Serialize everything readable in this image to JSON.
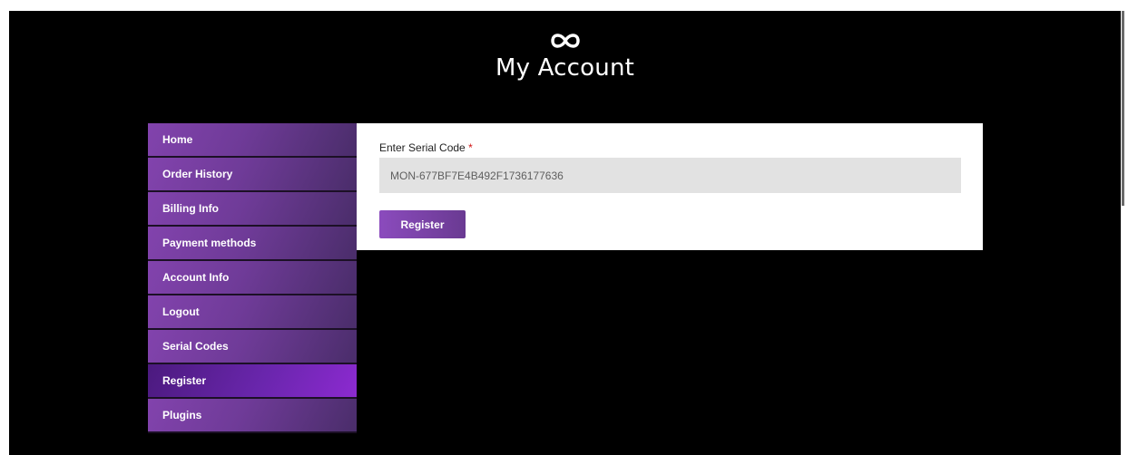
{
  "header": {
    "logo_icon": "infinity-icon",
    "title": "My Account"
  },
  "sidebar": {
    "items": [
      {
        "label": "Home"
      },
      {
        "label": "Order History"
      },
      {
        "label": "Billing Info"
      },
      {
        "label": "Payment methods"
      },
      {
        "label": "Account Info"
      },
      {
        "label": "Logout"
      },
      {
        "label": "Serial Codes"
      },
      {
        "label": "Register",
        "active": true
      },
      {
        "label": "Plugins"
      }
    ]
  },
  "form": {
    "label": "Enter Serial Code",
    "required_marker": "*",
    "serial_value": "MON-677BF7E4B492F1736177636",
    "submit_label": "Register"
  },
  "colors": {
    "background": "#000000",
    "accent": "#7a3fa8",
    "required": "#d11313"
  }
}
